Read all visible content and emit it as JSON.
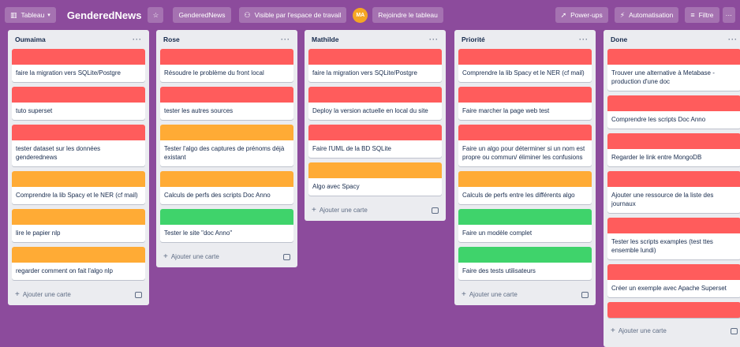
{
  "colors": {
    "red": "#ff5c5c",
    "orange": "#ffab35",
    "green": "#3fd36b",
    "background": "#8c4b9c"
  },
  "header": {
    "view_button": "Tableau",
    "board_name": "GenderedNews",
    "workspace_button": "GenderedNews",
    "visibility_button": "Visible par l'espace de travail",
    "avatar_initials": "MA",
    "join_button": "Rejoindre le tableau",
    "powerups_button": "Power-ups",
    "automation_button": "Automatisation",
    "filter_button": "Filtre"
  },
  "add_card_label": "Ajouter une carte",
  "lists": [
    {
      "title": "Oumaima",
      "cards": [
        {
          "label": "red",
          "text": "faire la migration vers SQLite/Postgre"
        },
        {
          "label": "red",
          "text": "tuto superset"
        },
        {
          "label": "red",
          "text": "tester dataset sur les données genderednews"
        },
        {
          "label": "orange",
          "text": "Comprendre la lib Spacy et le NER (cf mail)"
        },
        {
          "label": "orange",
          "text": "lire le papier nlp"
        },
        {
          "label": "orange",
          "text": "regarder comment on fait l'algo nlp"
        }
      ]
    },
    {
      "title": "Rose",
      "cards": [
        {
          "label": "red",
          "text": "Résoudre le problème du front local"
        },
        {
          "label": "red",
          "text": "tester les autres sources"
        },
        {
          "label": "orange",
          "text": "Tester l'algo des captures de prénoms déjà existant"
        },
        {
          "label": "orange",
          "text": "Calculs de perfs des scripts Doc Anno"
        },
        {
          "label": "green",
          "text": "Tester le site \"doc Anno\""
        }
      ]
    },
    {
      "title": "Mathilde",
      "cards": [
        {
          "label": "red",
          "text": "faire la migration vers SQLite/Postgre"
        },
        {
          "label": "red",
          "text": "Deploy la version actuelle en local du site"
        },
        {
          "label": "red",
          "text": "Faire l'UML de la BD SQLite"
        },
        {
          "label": "orange",
          "text": "Algo avec Spacy"
        }
      ]
    },
    {
      "title": "Priorité",
      "cards": [
        {
          "label": "red",
          "text": "Comprendre la lib Spacy et le NER (cf mail)"
        },
        {
          "label": "red",
          "text": "Faire marcher la page web test"
        },
        {
          "label": "red",
          "text": "Faire un algo pour déterminer si un nom est propre ou commun/ éliminer les confusions"
        },
        {
          "label": "orange",
          "text": "Calculs de perfs entre les différents algo"
        },
        {
          "label": "green",
          "text": "Faire un modèle complet"
        },
        {
          "label": "green",
          "text": "Faire des tests utilisateurs"
        }
      ]
    },
    {
      "title": "Done",
      "cards": [
        {
          "label": "red",
          "text": "Trouver une alternative à Metabase - production d'une doc"
        },
        {
          "label": "red",
          "text": "Comprendre les scripts Doc Anno"
        },
        {
          "label": "red",
          "text": "Regarder le link entre MongoDB"
        },
        {
          "label": "red",
          "text": "Ajouter une ressource de la liste des journaux"
        },
        {
          "label": "red",
          "text": "Tester les scripts examples (test ttes ensemble lundi)"
        },
        {
          "label": "red",
          "text": "Créer un exemple avec Apache Superset"
        },
        {
          "label": "red",
          "text": ""
        }
      ]
    }
  ]
}
